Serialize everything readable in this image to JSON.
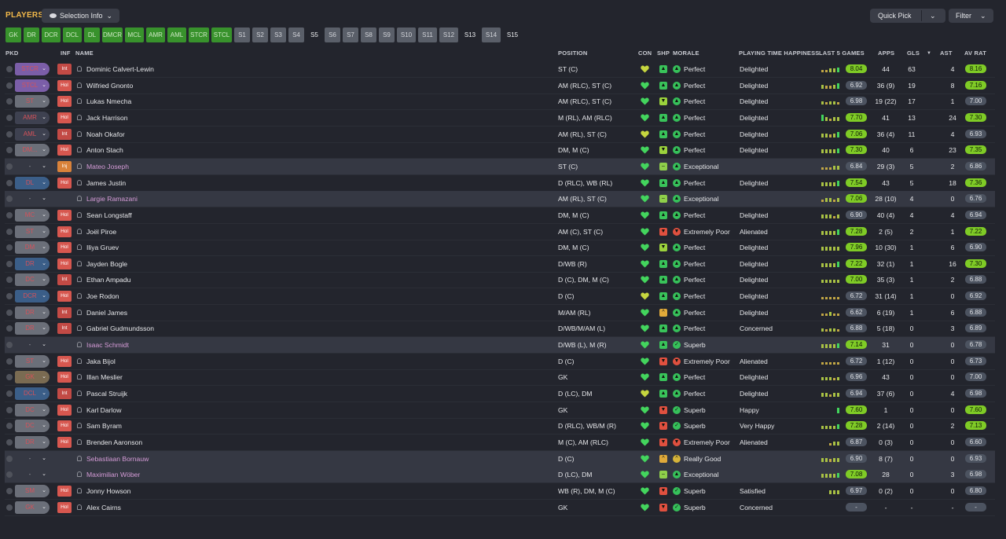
{
  "header": {
    "title": "PLAYERS",
    "selection_info": "Selection Info",
    "quick_pick": "Quick Pick",
    "filter": "Filter"
  },
  "tabs": [
    {
      "label": "GK",
      "style": "green"
    },
    {
      "label": "DR",
      "style": "green"
    },
    {
      "label": "DCR",
      "style": "green"
    },
    {
      "label": "DCL",
      "style": "green"
    },
    {
      "label": "DL",
      "style": "green"
    },
    {
      "label": "DMCR",
      "style": "green"
    },
    {
      "label": "MCL",
      "style": "green"
    },
    {
      "label": "AMR",
      "style": "green"
    },
    {
      "label": "AML",
      "style": "green"
    },
    {
      "label": "STCR",
      "style": "green"
    },
    {
      "label": "STCL",
      "style": "green"
    },
    {
      "label": "S1",
      "style": "grey"
    },
    {
      "label": "S2",
      "style": "grey"
    },
    {
      "label": "S3",
      "style": "grey"
    },
    {
      "label": "S4",
      "style": "grey"
    },
    {
      "label": "S5",
      "style": "dark"
    },
    {
      "label": "S6",
      "style": "grey"
    },
    {
      "label": "S7",
      "style": "grey"
    },
    {
      "label": "S8",
      "style": "grey"
    },
    {
      "label": "S9",
      "style": "grey"
    },
    {
      "label": "S10",
      "style": "grey"
    },
    {
      "label": "S11",
      "style": "grey"
    },
    {
      "label": "S12",
      "style": "grey"
    },
    {
      "label": "S13",
      "style": "dark"
    },
    {
      "label": "S14",
      "style": "grey"
    },
    {
      "label": "S15",
      "style": "dark"
    }
  ],
  "columns": {
    "pkd": "PKD",
    "inf": "INF",
    "name": "NAME",
    "position": "POSITION",
    "con": "CON",
    "shp": "SHP",
    "morale": "MORALE",
    "pth": "PLAYING TIME HAPPINESS",
    "last5": "LAST 5 GAMES",
    "apps": "APPS",
    "gls": "GLS",
    "sort_arrow": "▼",
    "ast": "AST",
    "avrat": "AV RAT"
  },
  "colors": {
    "rating_high": "#7fcb26",
    "rating_mid": "#4c5360",
    "morale_good": "#36c05a",
    "morale_bad": "#e0503f",
    "morale_warn": "#d6b43a"
  },
  "players": [
    {
      "pkd": "STCR",
      "pkd_color": "#7b5ea8",
      "inf": "Int",
      "name": "Dominic Calvert-Lewin",
      "loan": false,
      "position": "ST (C)",
      "con": "yellow",
      "shp": "up",
      "morale_icon": "up",
      "morale": "Perfect",
      "pth": "Delighted",
      "form": [
        4,
        5,
        6,
        6,
        7
      ],
      "l5": "8.04",
      "apps": "44",
      "gls": "63",
      "ast": "4",
      "av": "8.16",
      "hi": true
    },
    {
      "pkd": "STCL",
      "pkd_color": "#7b5ea8",
      "inf": "Hol",
      "name": "Wilfried Gnonto",
      "loan": false,
      "position": "AM (RLC), ST (C)",
      "con": "green",
      "shp": "up",
      "morale_icon": "up",
      "morale": "Perfect",
      "pth": "Delighted",
      "form": [
        6,
        5,
        5,
        6,
        7
      ],
      "l5": "6.92",
      "apps": "36 (9)",
      "gls": "19",
      "ast": "8",
      "av": "7.16",
      "hi": true
    },
    {
      "pkd": "ST",
      "pkd_color": "#6b6f79",
      "inf": "Hol",
      "name": "Lukas Nmecha",
      "loan": false,
      "position": "AM (RLC), ST (C)",
      "con": "green",
      "shp": "down",
      "morale_icon": "up",
      "morale": "Perfect",
      "pth": "Delighted",
      "form": [
        6,
        5,
        6,
        6,
        5
      ],
      "l5": "6.98",
      "apps": "19 (22)",
      "gls": "17",
      "ast": "1",
      "av": "7.00",
      "hi": false
    },
    {
      "pkd": "AMR",
      "pkd_color": "#3e4150",
      "inf": "Hol",
      "name": "Jack Harrison",
      "loan": false,
      "position": "M (RL), AM (RLC)",
      "con": "green",
      "shp": "up",
      "morale_icon": "up",
      "morale": "Perfect",
      "pth": "Delighted",
      "form": [
        8,
        6,
        5,
        6,
        6
      ],
      "l5": "7.70",
      "apps": "41",
      "gls": "13",
      "ast": "24",
      "av": "7.30",
      "hi": true
    },
    {
      "pkd": "AML",
      "pkd_color": "#3e4150",
      "inf": "Int",
      "name": "Noah Okafor",
      "loan": false,
      "position": "AM (RL), ST (C)",
      "con": "yellow",
      "shp": "up",
      "morale_icon": "up",
      "morale": "Perfect",
      "pth": "Delighted",
      "form": [
        6,
        6,
        5,
        6,
        7
      ],
      "l5": "7.06",
      "apps": "36 (4)",
      "gls": "11",
      "ast": "4",
      "av": "6.93",
      "hi": false
    },
    {
      "pkd": "DM...",
      "pkd_color": "#6b6f79",
      "inf": "Hol",
      "name": "Anton Stach",
      "loan": false,
      "position": "DM, M (C)",
      "con": "green",
      "shp": "down",
      "morale_icon": "up",
      "morale": "Perfect",
      "pth": "Delighted",
      "form": [
        6,
        6,
        6,
        6,
        7
      ],
      "l5": "7.30",
      "apps": "40",
      "gls": "6",
      "ast": "23",
      "av": "7.35",
      "hi": true
    },
    {
      "pkd": "-",
      "pkd_color": "",
      "inf": "Inj",
      "name": "Mateo Joseph",
      "loan": true,
      "position": "ST (C)",
      "con": "green",
      "shp": "flat",
      "morale_icon": "up",
      "morale": "Exceptional",
      "pth": "",
      "form": [
        5,
        5,
        5,
        6,
        6
      ],
      "l5": "6.84",
      "apps": "29 (3)",
      "gls": "5",
      "ast": "2",
      "av": "6.86",
      "hi": false
    },
    {
      "pkd": "DL",
      "pkd_color": "#3b5e88",
      "inf": "Hol",
      "name": "James Justin",
      "loan": false,
      "position": "D (RLC), WB (RL)",
      "con": "green",
      "shp": "up",
      "morale_icon": "up",
      "morale": "Perfect",
      "pth": "Delighted",
      "form": [
        6,
        6,
        6,
        6,
        7
      ],
      "l5": "7.54",
      "apps": "43",
      "gls": "5",
      "ast": "18",
      "av": "7.36",
      "hi": true
    },
    {
      "pkd": "-",
      "pkd_color": "",
      "inf": "",
      "name": "Largie Ramazani",
      "loan": true,
      "position": "AM (RL), ST (C)",
      "con": "green",
      "shp": "flat",
      "morale_icon": "up",
      "morale": "Exceptional",
      "pth": "",
      "form": [
        5,
        6,
        6,
        5,
        6
      ],
      "l5": "7.06",
      "apps": "28 (10)",
      "gls": "4",
      "ast": "0",
      "av": "6.76",
      "hi": false
    },
    {
      "pkd": "MC",
      "pkd_color": "#6b6f79",
      "inf": "Hol",
      "name": "Sean Longstaff",
      "loan": false,
      "position": "DM, M (C)",
      "con": "green",
      "shp": "up",
      "morale_icon": "up",
      "morale": "Perfect",
      "pth": "Delighted",
      "form": [
        6,
        6,
        6,
        5,
        6
      ],
      "l5": "6.90",
      "apps": "40 (4)",
      "gls": "4",
      "ast": "4",
      "av": "6.94",
      "hi": false
    },
    {
      "pkd": "ST",
      "pkd_color": "#6b6f79",
      "inf": "Hol",
      "name": "Joël Piroe",
      "loan": false,
      "position": "AM (C), ST (C)",
      "con": "green",
      "shp": "bad",
      "morale_icon": "bad",
      "morale": "Extremely Poor",
      "pth": "Alienated",
      "form": [
        6,
        6,
        6,
        6,
        7
      ],
      "l5": "7.28",
      "apps": "2 (5)",
      "gls": "2",
      "ast": "1",
      "av": "7.22",
      "hi": true
    },
    {
      "pkd": "DM",
      "pkd_color": "#6b6f79",
      "inf": "Hol",
      "name": "Iliya Gruev",
      "loan": false,
      "position": "DM, M (C)",
      "con": "green",
      "shp": "down",
      "morale_icon": "up",
      "morale": "Perfect",
      "pth": "Delighted",
      "form": [
        6,
        6,
        6,
        6,
        6
      ],
      "l5": "7.96",
      "apps": "10 (30)",
      "gls": "1",
      "ast": "6",
      "av": "6.90",
      "hi": false
    },
    {
      "pkd": "DR",
      "pkd_color": "#3b5e88",
      "inf": "Hol",
      "name": "Jayden Bogle",
      "loan": false,
      "position": "D/WB (R)",
      "con": "green",
      "shp": "up",
      "morale_icon": "up",
      "morale": "Perfect",
      "pth": "Delighted",
      "form": [
        6,
        6,
        6,
        6,
        7
      ],
      "l5": "7.22",
      "apps": "32 (1)",
      "gls": "1",
      "ast": "16",
      "av": "7.30",
      "hi": true
    },
    {
      "pkd": "DC",
      "pkd_color": "#6b6f79",
      "inf": "Int",
      "name": "Ethan Ampadu",
      "loan": false,
      "position": "D (C), DM, M (C)",
      "con": "green",
      "shp": "up",
      "morale_icon": "up",
      "morale": "Perfect",
      "pth": "Delighted",
      "form": [
        6,
        6,
        6,
        6,
        6
      ],
      "l5": "7.00",
      "apps": "35 (3)",
      "gls": "1",
      "ast": "2",
      "av": "6.88",
      "hi": false
    },
    {
      "pkd": "DCR",
      "pkd_color": "#3b5e88",
      "inf": "Hol",
      "name": "Joe Rodon",
      "loan": false,
      "position": "D (C)",
      "con": "yellow",
      "shp": "up",
      "morale_icon": "up",
      "morale": "Perfect",
      "pth": "Delighted",
      "form": [
        5,
        5,
        5,
        5,
        5
      ],
      "l5": "6.72",
      "apps": "31 (14)",
      "gls": "1",
      "ast": "0",
      "av": "6.92",
      "hi": false
    },
    {
      "pkd": "DR",
      "pkd_color": "#6b6f79",
      "inf": "Int",
      "name": "Daniel James",
      "loan": false,
      "position": "M/AM (RL)",
      "con": "green",
      "shp": "warn",
      "morale_icon": "up",
      "morale": "Perfect",
      "pth": "Delighted",
      "form": [
        5,
        5,
        6,
        5,
        5
      ],
      "l5": "6.62",
      "apps": "6 (19)",
      "gls": "1",
      "ast": "6",
      "av": "6.88",
      "hi": false
    },
    {
      "pkd": "DR",
      "pkd_color": "#6b6f79",
      "inf": "Int",
      "name": "Gabriel Gudmundsson",
      "loan": false,
      "position": "D/WB/M/AM (L)",
      "con": "green",
      "shp": "up",
      "morale_icon": "up",
      "morale": "Perfect",
      "pth": "Concerned",
      "form": [
        6,
        5,
        6,
        6,
        5
      ],
      "l5": "6.88",
      "apps": "5 (18)",
      "gls": "0",
      "ast": "3",
      "av": "6.89",
      "hi": false
    },
    {
      "pkd": "-",
      "pkd_color": "",
      "inf": "",
      "name": "Isaac Schmidt",
      "loan": true,
      "position": "D/WB (L), M (R)",
      "con": "green",
      "shp": "up",
      "morale_icon": "check",
      "morale": "Superb",
      "pth": "",
      "form": [
        6,
        6,
        6,
        6,
        7
      ],
      "l5": "7.14",
      "apps": "31",
      "gls": "0",
      "ast": "0",
      "av": "6.78",
      "hi": false
    },
    {
      "pkd": "ST",
      "pkd_color": "#6b6f79",
      "inf": "Hol",
      "name": "Jaka Bijol",
      "loan": false,
      "position": "D (C)",
      "con": "green",
      "shp": "bad",
      "morale_icon": "bad",
      "morale": "Extremely Poor",
      "pth": "Alienated",
      "form": [
        5,
        5,
        5,
        5,
        5
      ],
      "l5": "6.72",
      "apps": "1 (12)",
      "gls": "0",
      "ast": "0",
      "av": "6.73",
      "hi": false
    },
    {
      "pkd": "GK",
      "pkd_color": "#7a6b52",
      "inf": "Hol",
      "name": "Illan Meslier",
      "loan": false,
      "position": "GK",
      "con": "green",
      "shp": "up",
      "morale_icon": "up",
      "morale": "Perfect",
      "pth": "Delighted",
      "form": [
        6,
        6,
        6,
        5,
        6
      ],
      "l5": "6.96",
      "apps": "43",
      "gls": "0",
      "ast": "0",
      "av": "7.00",
      "hi": false
    },
    {
      "pkd": "DCL",
      "pkd_color": "#3b5e88",
      "inf": "Int",
      "name": "Pascal Struijk",
      "loan": false,
      "position": "D (LC), DM",
      "con": "yellow",
      "shp": "up",
      "morale_icon": "up",
      "morale": "Perfect",
      "pth": "Delighted",
      "form": [
        6,
        6,
        5,
        6,
        6
      ],
      "l5": "6.94",
      "apps": "37 (6)",
      "gls": "0",
      "ast": "4",
      "av": "6.98",
      "hi": false
    },
    {
      "pkd": "DC",
      "pkd_color": "#6b6f79",
      "inf": "Hol",
      "name": "Karl Darlow",
      "loan": false,
      "position": "GK",
      "con": "green",
      "shp": "bad",
      "morale_icon": "check",
      "morale": "Superb",
      "pth": "Happy",
      "form": [
        0,
        0,
        0,
        0,
        7
      ],
      "l5": "7.60",
      "apps": "1",
      "gls": "0",
      "ast": "0",
      "av": "7.60",
      "hi": true
    },
    {
      "pkd": "DC",
      "pkd_color": "#6b6f79",
      "inf": "Hol",
      "name": "Sam Byram",
      "loan": false,
      "position": "D (RLC), WB/M (R)",
      "con": "green",
      "shp": "bad",
      "morale_icon": "check",
      "morale": "Superb",
      "pth": "Very Happy",
      "form": [
        6,
        6,
        6,
        6,
        7
      ],
      "l5": "7.28",
      "apps": "2 (14)",
      "gls": "0",
      "ast": "2",
      "av": "7.13",
      "hi": true
    },
    {
      "pkd": "DR",
      "pkd_color": "#6b6f79",
      "inf": "Hol",
      "name": "Brenden Aaronson",
      "loan": false,
      "position": "M (C), AM (RLC)",
      "con": "green",
      "shp": "bad",
      "morale_icon": "bad",
      "morale": "Extremely Poor",
      "pth": "Alienated",
      "form": [
        0,
        0,
        5,
        6,
        6
      ],
      "l5": "6.87",
      "apps": "0 (3)",
      "gls": "0",
      "ast": "0",
      "av": "6.60",
      "hi": false
    },
    {
      "pkd": "-",
      "pkd_color": "",
      "inf": "",
      "name": "Sebastiaan Bornauw",
      "loan": true,
      "position": "D (C)",
      "con": "green",
      "shp": "warn",
      "morale_icon": "warn",
      "morale": "Really Good",
      "pth": "",
      "form": [
        6,
        6,
        5,
        6,
        6
      ],
      "l5": "6.90",
      "apps": "8 (7)",
      "gls": "0",
      "ast": "0",
      "av": "6.93",
      "hi": false
    },
    {
      "pkd": "-",
      "pkd_color": "",
      "inf": "",
      "name": "Maximilian Wöber",
      "loan": true,
      "position": "D (LC), DM",
      "con": "green",
      "shp": "flat",
      "morale_icon": "up",
      "morale": "Exceptional",
      "pth": "",
      "form": [
        6,
        6,
        6,
        6,
        7
      ],
      "l5": "7.08",
      "apps": "28",
      "gls": "0",
      "ast": "3",
      "av": "6.98",
      "hi": false
    },
    {
      "pkd": "SM",
      "pkd_color": "#6b6f79",
      "inf": "Hol",
      "name": "Jonny Howson",
      "loan": false,
      "position": "WB (R), DM, M (C)",
      "con": "green",
      "shp": "bad",
      "morale_icon": "check",
      "morale": "Superb",
      "pth": "Satisfied",
      "form": [
        0,
        0,
        6,
        6,
        6
      ],
      "l5": "6.97",
      "apps": "0 (2)",
      "gls": "0",
      "ast": "0",
      "av": "6.80",
      "hi": false
    },
    {
      "pkd": "GK",
      "pkd_color": "#6b6f79",
      "inf": "Hol",
      "name": "Alex Cairns",
      "loan": false,
      "position": "GK",
      "con": "green",
      "shp": "bad",
      "morale_icon": "check",
      "morale": "Superb",
      "pth": "Concerned",
      "form": [
        0,
        0,
        0,
        0,
        0
      ],
      "l5": "-",
      "apps": "-",
      "gls": "-",
      "ast": "-",
      "av": "-",
      "hi": false
    }
  ]
}
